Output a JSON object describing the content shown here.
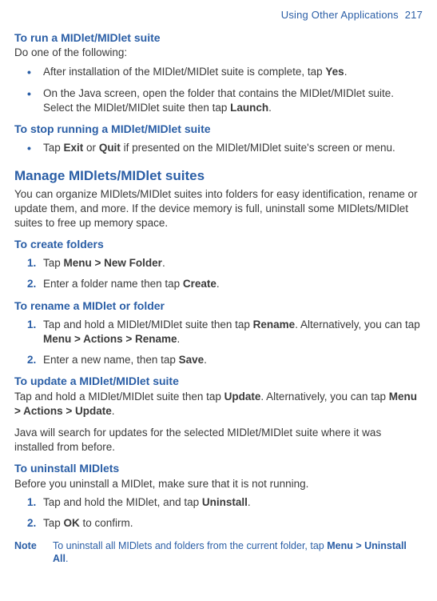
{
  "header": {
    "label": "Using Other Applications",
    "page": "217"
  },
  "sections": {
    "run": {
      "title": "To run a MIDlet/MIDlet suite",
      "intro": "Do one of the following:",
      "items": [
        {
          "pre": "After installation of the MIDlet/MIDlet suite is complete, tap ",
          "bold1": "Yes",
          "post": "."
        },
        {
          "pre": "On the Java screen, open the folder that contains the MIDlet/MIDlet suite. Select the MIDlet/MIDlet suite then tap ",
          "bold1": "Launch",
          "post": "."
        }
      ]
    },
    "stop": {
      "title": "To stop running a MIDlet/MIDlet suite",
      "items": [
        {
          "pre": "Tap ",
          "bold1": "Exit",
          "mid": " or ",
          "bold2": "Quit",
          "post": " if presented on the MIDlet/MIDlet suite's screen or menu."
        }
      ]
    },
    "manage": {
      "title": "Manage MIDlets/MIDlet suites",
      "intro": "You can organize MIDlets/MIDlet suites into folders for easy identification, rename or update them, and more. If the device memory is full, uninstall some MIDlets/MIDlet suites to free up memory space."
    },
    "create": {
      "title": "To create folders",
      "items": [
        {
          "num": "1.",
          "pre": "Tap ",
          "bold1": "Menu > New Folder",
          "post": "."
        },
        {
          "num": "2.",
          "pre": "Enter a folder name then tap ",
          "bold1": "Create",
          "post": "."
        }
      ]
    },
    "rename": {
      "title": "To rename a MIDlet or folder",
      "items": [
        {
          "num": "1.",
          "pre": "Tap and hold a MIDlet/MIDlet suite then tap ",
          "bold1": "Rename",
          "mid": ". Alternatively, you can tap ",
          "bold2": "Menu > Actions > Rename",
          "post": "."
        },
        {
          "num": "2.",
          "pre": "Enter a new name, then tap ",
          "bold1": "Save",
          "post": "."
        }
      ]
    },
    "update": {
      "title": "To update a MIDlet/MIDlet suite",
      "para1": {
        "pre": "Tap and hold a MIDlet/MIDlet suite then tap ",
        "bold1": "Update",
        "mid": ". Alternatively, you can tap ",
        "bold2": "Menu > Actions > Update",
        "post": "."
      },
      "para2": "Java will search for updates for the selected MIDlet/MIDlet suite where it was installed from before."
    },
    "uninstall": {
      "title": "To uninstall MIDlets",
      "intro": "Before you uninstall a MIDlet, make sure that it is not running.",
      "items": [
        {
          "num": "1.",
          "pre": "Tap and hold the MIDlet, and tap ",
          "bold1": "Uninstall",
          "post": "."
        },
        {
          "num": "2.",
          "pre": "Tap ",
          "bold1": "OK",
          "post": " to confirm."
        }
      ]
    },
    "note": {
      "label": "Note",
      "text_pre": "To uninstall all MIDlets and folders from the current folder, tap ",
      "bold": "Menu > Uninstall All",
      "text_post": "."
    }
  }
}
